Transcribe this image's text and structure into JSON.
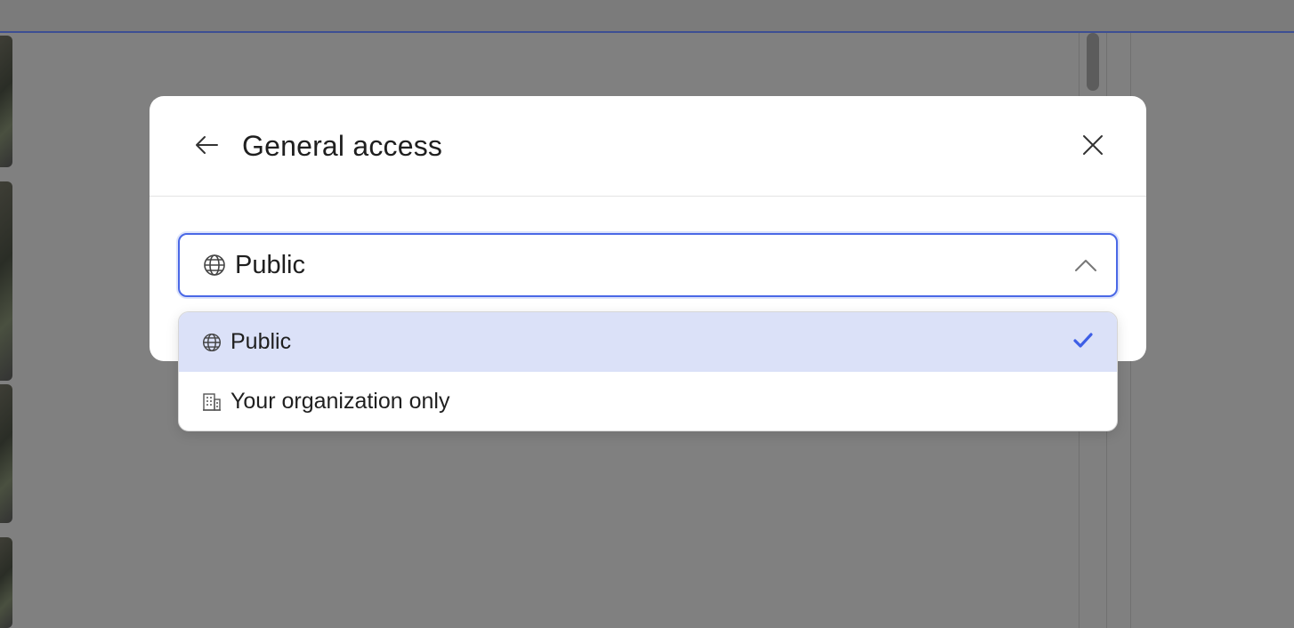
{
  "dialog": {
    "title": "General access",
    "back_icon": "arrow-left-icon",
    "close_icon": "close-icon"
  },
  "access_select": {
    "value": "Public",
    "icon": "globe-icon",
    "expanded": true
  },
  "options": [
    {
      "label": "Public",
      "icon": "globe-icon",
      "selected": true
    },
    {
      "label": "Your organization only",
      "icon": "building-icon",
      "selected": false
    }
  ],
  "colors": {
    "accent": "#4a68e6",
    "selected_bg": "#dbe1f8",
    "check": "#3d5ee6",
    "overlay": "#808080"
  }
}
